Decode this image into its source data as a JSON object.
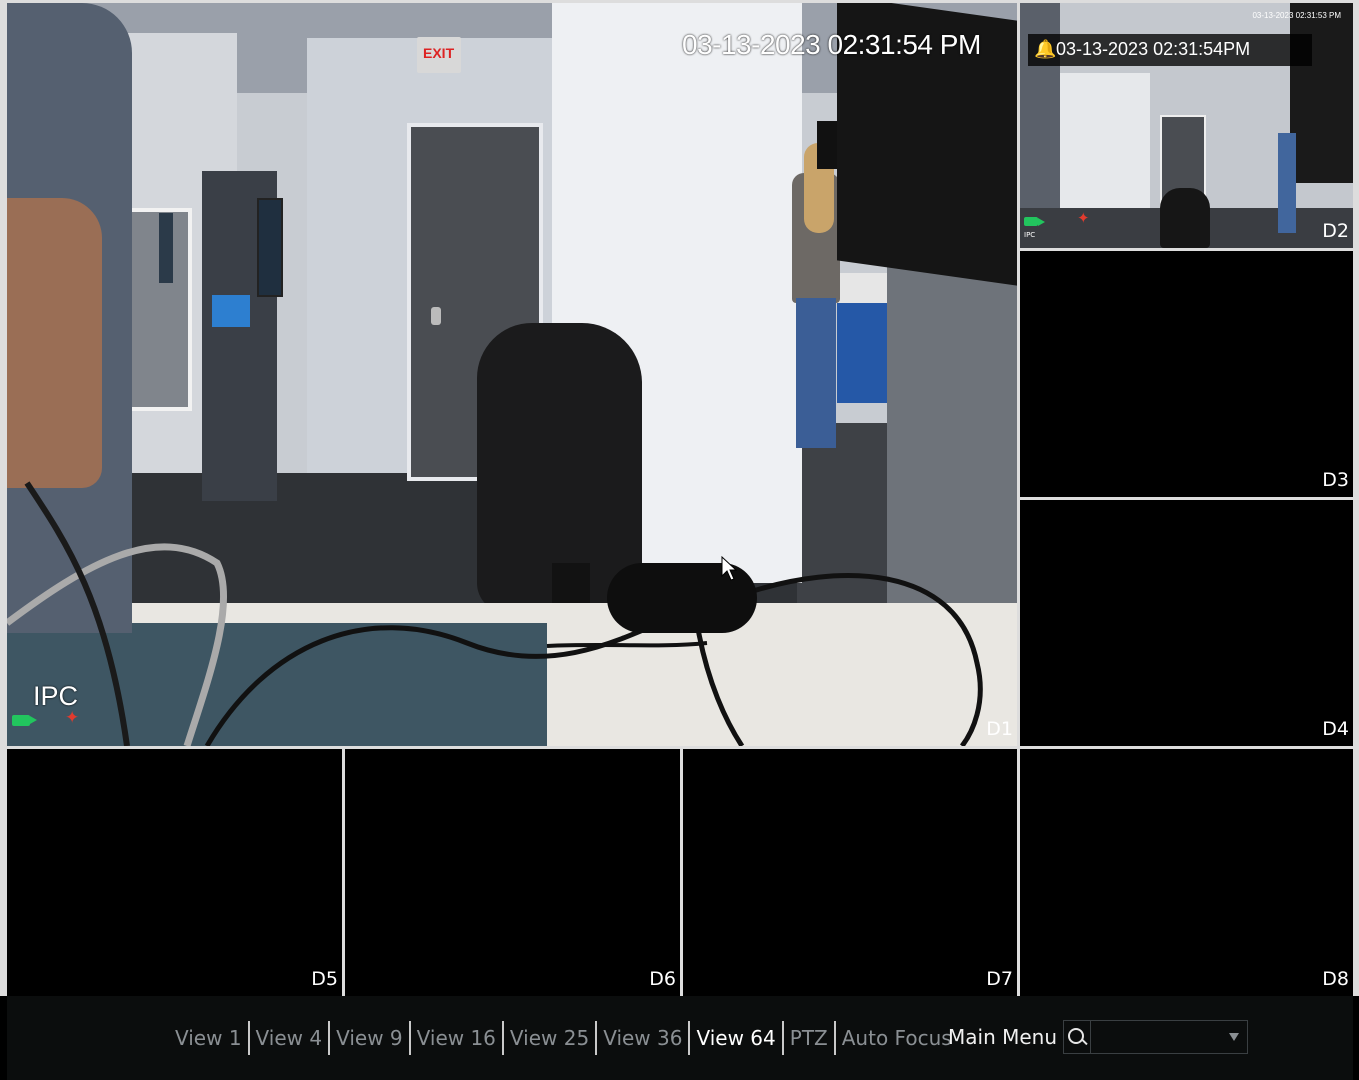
{
  "d1": {
    "label": "D1",
    "timestamp": "03-13-2023 02:31:54 PM",
    "source": "IPC",
    "exit_sign": "EXIT"
  },
  "d2": {
    "label": "D2",
    "alarm_timestamp": "03-13-2023 02:31:54PM",
    "mini_timestamp": "03-13-2023 02:31:53 PM",
    "source": "IPC"
  },
  "channels": {
    "d3": "D3",
    "d4": "D4",
    "d5": "D5",
    "d6": "D6",
    "d7": "D7",
    "d8": "D8"
  },
  "bottom_bar": {
    "views": [
      "View 1",
      "View 4",
      "View 9",
      "View 16",
      "View 25",
      "View 36",
      "View 64",
      "PTZ",
      "Auto Focus"
    ],
    "active_view": "View 64",
    "main_menu": "Main Menu",
    "search_value": ""
  },
  "colors": {
    "active_text": "#ffffff",
    "inactive_text": "#8a8f93",
    "record_icon": "#22c55e",
    "motion_alarm": "#e23b2e"
  }
}
